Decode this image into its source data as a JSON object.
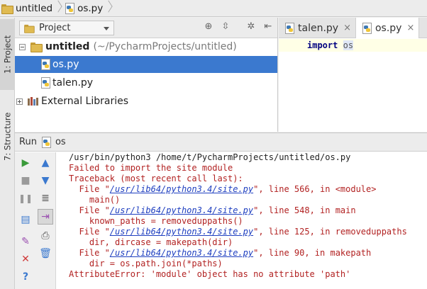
{
  "breadcrumb": {
    "project": "untitled",
    "file": "os.py"
  },
  "tool_strip": {
    "project_tab": "1: Project",
    "structure_tab": "7: Structure"
  },
  "project_panel": {
    "view_selector": "Project",
    "tree": [
      {
        "label": "untitled",
        "suffix": "(~/PycharmProjects/untitled)",
        "type": "folder"
      },
      {
        "label": "os.py",
        "type": "python",
        "selected": true
      },
      {
        "label": "talen.py",
        "type": "python"
      },
      {
        "label": "External Libraries",
        "type": "library"
      }
    ]
  },
  "editor": {
    "tabs": [
      {
        "label": "talen.py",
        "close": "×"
      },
      {
        "label": "os.py",
        "close": "×",
        "active": true
      }
    ],
    "code_keyword": "import",
    "code_module": "os"
  },
  "run_panel": {
    "title": "Run",
    "config": "os",
    "output": [
      {
        "text": "/usr/bin/python3 /home/t/PycharmProjects/untitled/os.py",
        "kind": "cmd"
      },
      {
        "text": "Failed to import the site module",
        "kind": "err"
      },
      {
        "text": "Traceback (most recent call last):",
        "kind": "err"
      },
      {
        "pre": "  File \"",
        "link": "/usr/lib64/python3.4/site.py",
        "post": "\", line 566, in <module>",
        "kind": "err"
      },
      {
        "text": "    main()",
        "kind": "err"
      },
      {
        "pre": "  File \"",
        "link": "/usr/lib64/python3.4/site.py",
        "post": "\", line 548, in main",
        "kind": "err"
      },
      {
        "text": "    known_paths = removeduppaths()",
        "kind": "err"
      },
      {
        "pre": "  File \"",
        "link": "/usr/lib64/python3.4/site.py",
        "post": "\", line 125, in removeduppaths",
        "kind": "err"
      },
      {
        "text": "    dir, dircase = makepath(dir)",
        "kind": "err"
      },
      {
        "pre": "  File \"",
        "link": "/usr/lib64/python3.4/site.py",
        "post": "\", line 90, in makepath",
        "kind": "err"
      },
      {
        "text": "    dir = os.path.join(*paths)",
        "kind": "err"
      },
      {
        "text": "AttributeError: 'module' object has no attribute 'path'",
        "kind": "err"
      }
    ]
  },
  "colors": {
    "selection": "#3b79cf",
    "error_text": "#b22222",
    "link_text": "#2040c0"
  }
}
